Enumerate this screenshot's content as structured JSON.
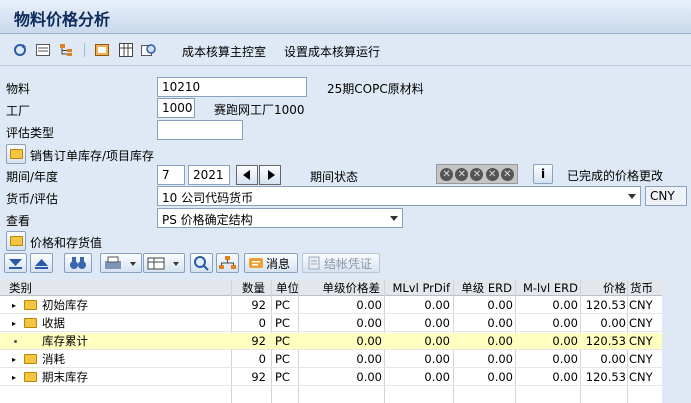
{
  "title": "物料价格分析",
  "toolbar": {
    "cost_cockpit": "成本核算主控室",
    "setup_cost_run": "设置成本核算运行"
  },
  "form": {
    "material_label": "物料",
    "material_value": "10210",
    "material_desc": "25期COPC原材料",
    "plant_label": "工厂",
    "plant_value": "1000",
    "plant_desc": "赛跑网工厂1000",
    "valtype_label": "评估类型",
    "valtype_value": "",
    "sales_stock_label": "销售订单库存/项目库存",
    "period_label": "期间/年度",
    "period_value": "7",
    "year_value": "2021",
    "period_status_label": "期间状态",
    "completed_label": "已完成的价格更改",
    "currency_label": "货币/评估",
    "currency_value": "10 公司代码货币",
    "currency_code": "CNY",
    "view_label": "查看",
    "view_value": "PS 价格确定结构",
    "price_stock_label": "价格和存货值"
  },
  "grid_toolbar": {
    "message": "消息",
    "post_closing": "结帐凭证"
  },
  "table": {
    "headers": {
      "category": "类别",
      "qty": "数量",
      "unit": "单位",
      "single_level_diff": "单级价格差",
      "mlvl_prdif": "MLvl PrDif",
      "single_erd": "单级 ERD",
      "mlvl_erd": "M-lvl ERD",
      "price": "价格",
      "currency": "货币"
    },
    "rows": [
      {
        "category": "初始库存",
        "qty": "92",
        "unit": "PC",
        "sld": "0.00",
        "mpd": "0.00",
        "serd": "0.00",
        "merd": "0.00",
        "price": "120.53",
        "cur": "CNY"
      },
      {
        "category": "收据",
        "qty": "0",
        "unit": "PC",
        "sld": "0.00",
        "mpd": "0.00",
        "serd": "0.00",
        "merd": "0.00",
        "price": "0.00",
        "cur": "CNY"
      },
      {
        "category": "库存累计",
        "qty": "92",
        "unit": "PC",
        "sld": "0.00",
        "mpd": "0.00",
        "serd": "0.00",
        "merd": "0.00",
        "price": "120.53",
        "cur": "CNY"
      },
      {
        "category": "消耗",
        "qty": "0",
        "unit": "PC",
        "sld": "0.00",
        "mpd": "0.00",
        "serd": "0.00",
        "merd": "0.00",
        "price": "0.00",
        "cur": "CNY"
      },
      {
        "category": "期末库存",
        "qty": "92",
        "unit": "PC",
        "sld": "0.00",
        "mpd": "0.00",
        "serd": "0.00",
        "merd": "0.00",
        "price": "120.53",
        "cur": "CNY"
      }
    ]
  },
  "colors": {
    "highlight_row": "#ffffc0",
    "title_text": "#0d2b5a"
  }
}
